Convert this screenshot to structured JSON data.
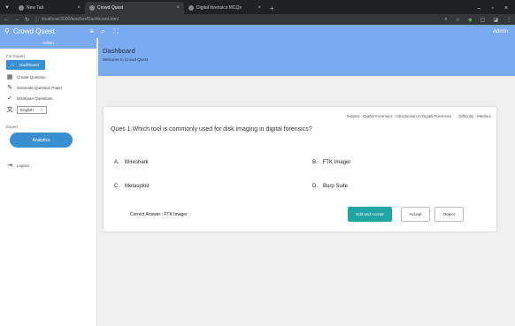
{
  "browser": {
    "tabs": [
      {
        "label": "New Tab"
      },
      {
        "label": "Crowd Quest"
      },
      {
        "label": "Digital forensics MCQs"
      }
    ],
    "url": "localhost:3000/teacher/Dashboard.html"
  },
  "header": {
    "brand": "Crowd Quest",
    "admin_label": "Admin"
  },
  "sidebar": {
    "admin_label": "Admin",
    "section_for_expert": "For Expert",
    "items": [
      {
        "label": "Dashboard"
      },
      {
        "label": "Create Question"
      },
      {
        "label": "Generate Question Paper"
      },
      {
        "label": "Distribute Questions"
      }
    ],
    "language": "English",
    "section_expert": "Expert",
    "analytics_label": "Analytics",
    "logout_label": "Logout"
  },
  "main": {
    "title": "Dashboard",
    "subtitle": "Welcome to Crowd Quest"
  },
  "question": {
    "subject": "Subject : Digital Forensics : Introduction to Digital Forensics",
    "difficulty": "Difficulty : Medium",
    "text": "Ques 1.Which tool is commonly used for disk imaging in digital forensics?",
    "options": [
      {
        "letter": "A.",
        "text": "Wireshark"
      },
      {
        "letter": "B.",
        "text": "FTK Imager"
      },
      {
        "letter": "C.",
        "text": "Metasploit"
      },
      {
        "letter": "D.",
        "text": "Burp Suite"
      }
    ],
    "correct_answer": "Correct Answer : FTK Imager",
    "edit_accept_label": "Edit and Accept",
    "accept_label": "Accept",
    "reject_label": "Reject"
  }
}
